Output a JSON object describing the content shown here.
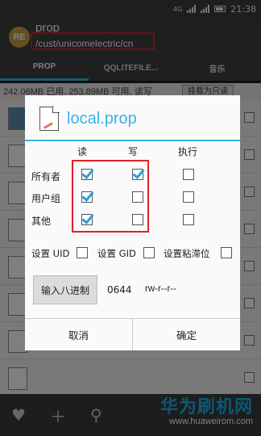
{
  "status_bar": {
    "network": "4G",
    "time": "21:38"
  },
  "header": {
    "app_icon_text": "RE",
    "title": "prop",
    "path": "/cust/unicomelectric/cn"
  },
  "tabs": [
    {
      "label": "PROP"
    },
    {
      "label": "QQLITEFILE..."
    },
    {
      "label": "音乐"
    }
  ],
  "storage_info": {
    "text": "242.06MB 已用, 253.89MB 可用, 读写",
    "button": "挂载为只读"
  },
  "dialog": {
    "title": "local.prop",
    "columns": [
      "读",
      "写",
      "执行"
    ],
    "rows": [
      {
        "label": "所有者",
        "read": true,
        "write": true,
        "execute": false
      },
      {
        "label": "用户组",
        "read": true,
        "write": false,
        "execute": false
      },
      {
        "label": "其他",
        "read": true,
        "write": false,
        "execute": false
      }
    ],
    "options": [
      {
        "label": "设置 UID",
        "checked": false
      },
      {
        "label": "设置 GID",
        "checked": false
      },
      {
        "label": "设置粘滞位",
        "checked": false
      }
    ],
    "octal_button": "输入八进制",
    "octal_value": "0644",
    "permission_string": "rw-r--r--",
    "cancel": "取消",
    "confirm": "确定"
  },
  "watermark": {
    "cn": "华为刷机网",
    "url": "www.huaweirom.com"
  },
  "colors": {
    "accent": "#33b5e5",
    "highlight": "#e0202a",
    "check": "#2a9fd6"
  }
}
